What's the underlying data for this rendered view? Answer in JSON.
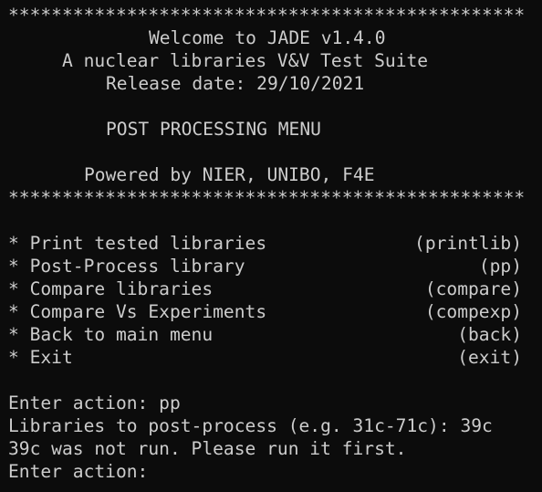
{
  "colors": {
    "background": "#0c0c0c",
    "foreground": "#cccccc"
  },
  "banner": {
    "border": "************************************************",
    "welcome": "Welcome to JADE v1.4.0",
    "subtitle": "A nuclear libraries V&V Test Suite",
    "release": "Release date: 29/10/2021",
    "menu_title": "POST PROCESSING MENU",
    "powered_by": "Powered by NIER, UNIBO, F4E"
  },
  "menu": {
    "items": [
      {
        "label": "* Print tested libraries",
        "command": "(printlib)"
      },
      {
        "label": "* Post-Process library",
        "command": "(pp)"
      },
      {
        "label": "* Compare libraries",
        "command": "(compare)"
      },
      {
        "label": "* Compare Vs Experiments",
        "command": "(compexp)"
      },
      {
        "label": "* Back to main menu",
        "command": "(back)"
      },
      {
        "label": "* Exit",
        "command": "(exit)"
      }
    ]
  },
  "session": {
    "lines": [
      "Enter action: pp",
      "Libraries to post-process (e.g. 31c-71c): 39c",
      "39c was not run. Please run it first.",
      "Enter action: "
    ]
  }
}
